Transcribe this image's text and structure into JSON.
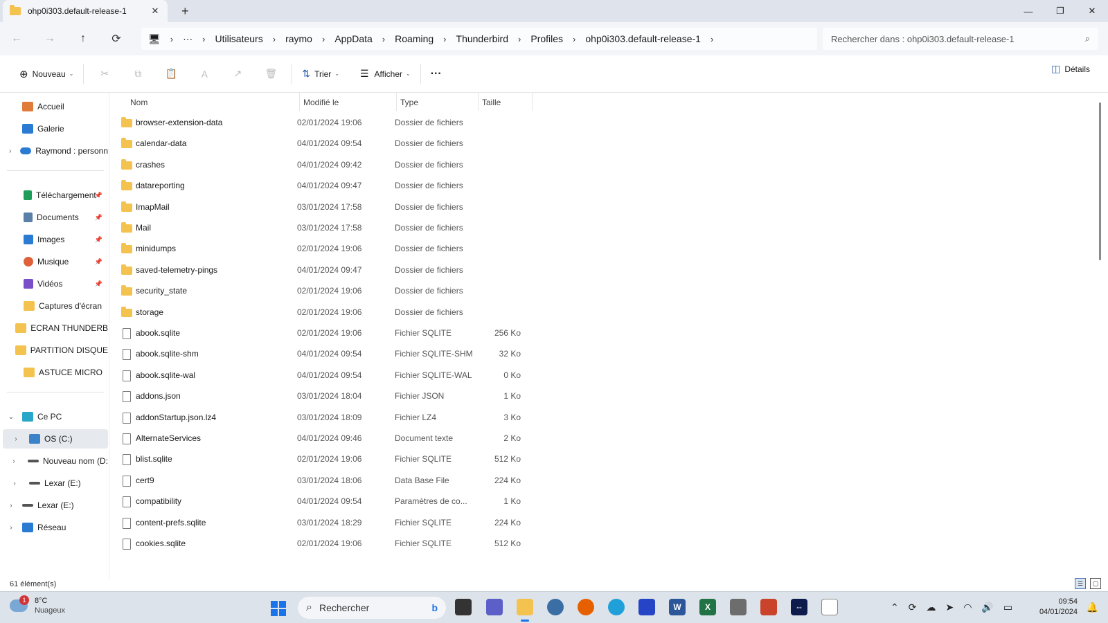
{
  "window": {
    "tab_title": "ohp0i303.default-release-1",
    "close_tab": "✕",
    "new_tab": "+",
    "minimize": "—",
    "restore": "❐",
    "close": "✕"
  },
  "nav": {
    "back": "←",
    "forward": "→",
    "up": "↑",
    "refresh": "⟳"
  },
  "breadcrumb": {
    "pc_icon": "🖥",
    "ellipsis": "···",
    "separator": "›",
    "items": [
      "Utilisateurs",
      "raymo",
      "AppData",
      "Roaming",
      "Thunderbird",
      "Profiles",
      "ohp0i303.default-release-1"
    ]
  },
  "search": {
    "placeholder": "Rechercher dans : ohp0i303.default-release-1",
    "icon": "⌕"
  },
  "toolbar": {
    "new_label": "Nouveau",
    "new_icon": "⊕",
    "sort_label": "Trier",
    "sort_icon": "⇅",
    "view_label": "Afficher",
    "view_icon": "☰",
    "more": "···",
    "details_label": "Détails",
    "details_icon": "◫",
    "chevron": "⌄",
    "cut_icon": "✂",
    "copy_icon": "⧉",
    "paste_icon": "📋",
    "rename_icon": "A",
    "share_icon": "↗",
    "delete_icon": "🗑"
  },
  "sidebar": {
    "expand": "›",
    "collapse": "⌄",
    "pin": "📌",
    "quick": [
      {
        "label": "Accueil",
        "icon": "home-icon",
        "color": "#e07b39"
      },
      {
        "label": "Galerie",
        "icon": "gallery-icon",
        "color": "#2b7bd3"
      },
      {
        "label": "Raymond : personn",
        "icon": "onedrive-icon",
        "color": "#2b7bd3"
      }
    ],
    "pinned": [
      {
        "label": "Téléchargement",
        "icon": "download-icon",
        "color": "#1e9e5a"
      },
      {
        "label": "Documents",
        "icon": "documents-icon",
        "color": "#5a7fa8"
      },
      {
        "label": "Images",
        "icon": "images-icon",
        "color": "#2b7bd3"
      },
      {
        "label": "Musique",
        "icon": "music-icon",
        "color": "#e0603a"
      },
      {
        "label": "Vidéos",
        "icon": "videos-icon",
        "color": "#7b4ec9"
      }
    ],
    "folders": [
      "Captures d'écran",
      "ECRAN THUNDERB",
      "PARTITION DISQUE",
      "ASTUCE MICRO"
    ],
    "pc": {
      "label": "Ce PC"
    },
    "drives": [
      {
        "label": "OS (C:)",
        "selected": true
      },
      {
        "label": "Nouveau nom (D:"
      },
      {
        "label": "Lexar (E:)"
      }
    ],
    "lexar_root": "Lexar (E:)",
    "network": "Réseau"
  },
  "columns": {
    "name": "Nom",
    "modified": "Modifié le",
    "type": "Type",
    "size": "Taille",
    "sort_arrow": "^"
  },
  "files": [
    {
      "name": "browser-extension-data",
      "date": "02/01/2024 19:06",
      "type": "Dossier de fichiers",
      "size": "",
      "kind": "folder"
    },
    {
      "name": "calendar-data",
      "date": "04/01/2024 09:54",
      "type": "Dossier de fichiers",
      "size": "",
      "kind": "folder"
    },
    {
      "name": "crashes",
      "date": "04/01/2024 09:42",
      "type": "Dossier de fichiers",
      "size": "",
      "kind": "folder"
    },
    {
      "name": "datareporting",
      "date": "04/01/2024 09:47",
      "type": "Dossier de fichiers",
      "size": "",
      "kind": "folder"
    },
    {
      "name": "ImapMail",
      "date": "03/01/2024 17:58",
      "type": "Dossier de fichiers",
      "size": "",
      "kind": "folder"
    },
    {
      "name": "Mail",
      "date": "03/01/2024 17:58",
      "type": "Dossier de fichiers",
      "size": "",
      "kind": "folder"
    },
    {
      "name": "minidumps",
      "date": "02/01/2024 19:06",
      "type": "Dossier de fichiers",
      "size": "",
      "kind": "folder"
    },
    {
      "name": "saved-telemetry-pings",
      "date": "04/01/2024 09:47",
      "type": "Dossier de fichiers",
      "size": "",
      "kind": "folder"
    },
    {
      "name": "security_state",
      "date": "02/01/2024 19:06",
      "type": "Dossier de fichiers",
      "size": "",
      "kind": "folder"
    },
    {
      "name": "storage",
      "date": "02/01/2024 19:06",
      "type": "Dossier de fichiers",
      "size": "",
      "kind": "folder"
    },
    {
      "name": "abook.sqlite",
      "date": "02/01/2024 19:06",
      "type": "Fichier SQLITE",
      "size": "256 Ko",
      "kind": "file"
    },
    {
      "name": "abook.sqlite-shm",
      "date": "04/01/2024 09:54",
      "type": "Fichier SQLITE-SHM",
      "size": "32 Ko",
      "kind": "file"
    },
    {
      "name": "abook.sqlite-wal",
      "date": "04/01/2024 09:54",
      "type": "Fichier SQLITE-WAL",
      "size": "0 Ko",
      "kind": "file"
    },
    {
      "name": "addons.json",
      "date": "03/01/2024 18:04",
      "type": "Fichier JSON",
      "size": "1 Ko",
      "kind": "file"
    },
    {
      "name": "addonStartup.json.lz4",
      "date": "03/01/2024 18:09",
      "type": "Fichier LZ4",
      "size": "3 Ko",
      "kind": "file"
    },
    {
      "name": "AlternateServices",
      "date": "04/01/2024 09:46",
      "type": "Document texte",
      "size": "2 Ko",
      "kind": "file"
    },
    {
      "name": "blist.sqlite",
      "date": "02/01/2024 19:06",
      "type": "Fichier SQLITE",
      "size": "512 Ko",
      "kind": "file"
    },
    {
      "name": "cert9",
      "date": "03/01/2024 18:06",
      "type": "Data Base File",
      "size": "224 Ko",
      "kind": "file"
    },
    {
      "name": "compatibility",
      "date": "04/01/2024 09:54",
      "type": "Paramètres de co...",
      "size": "1 Ko",
      "kind": "file"
    },
    {
      "name": "content-prefs.sqlite",
      "date": "03/01/2024 18:29",
      "type": "Fichier SQLITE",
      "size": "224 Ko",
      "kind": "file"
    },
    {
      "name": "cookies.sqlite",
      "date": "02/01/2024 19:06",
      "type": "Fichier SQLITE",
      "size": "512 Ko",
      "kind": "file"
    }
  ],
  "status": {
    "count": "61 élément(s)",
    "details_view": "☰",
    "tiles_view": "▢"
  },
  "taskbar": {
    "temperature": "8°C",
    "condition": "Nuageux",
    "notification_count": "1",
    "search_label": "Rechercher",
    "search_icon": "⌕",
    "bing": "b",
    "time": "09:54",
    "date": "04/01/2024",
    "tray_up": "⌃",
    "tray_sync": "⟳",
    "tray_cloud": "☁",
    "tray_send": "➤",
    "tray_wifi": "◠",
    "tray_volume": "🔊",
    "tray_battery": "▭",
    "bell": "🔔",
    "word": "W",
    "excel": "X",
    "teamviewer": "⇔"
  }
}
